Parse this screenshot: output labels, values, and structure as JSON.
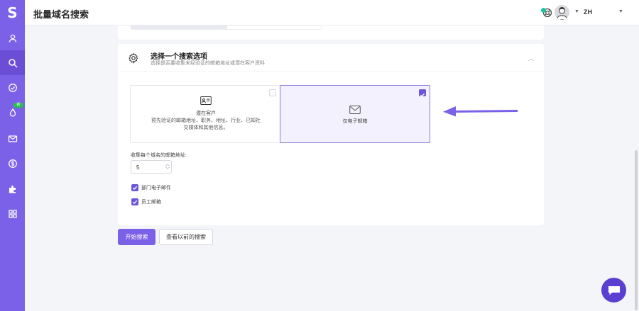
{
  "app": {
    "logo_letter": "S",
    "page_title": "批量域名搜索",
    "lang": "ZH",
    "new_badge": "新"
  },
  "sidebar": {
    "items": [
      {
        "icon": "user-icon"
      },
      {
        "icon": "search-icon",
        "active": true
      },
      {
        "icon": "check-circle-icon"
      },
      {
        "icon": "fire-icon"
      },
      {
        "icon": "mail-icon"
      },
      {
        "icon": "dollar-icon"
      },
      {
        "icon": "puzzle-icon"
      },
      {
        "icon": "grid-icon"
      }
    ]
  },
  "card": {
    "title": "选择一个搜索选项",
    "subtitle": "选择是否要收集未经验证的邮箱地址或潜在客户资料"
  },
  "options": {
    "left": {
      "label": "潜在客户",
      "desc_line1": "预先验证的邮箱地址、职务、地址、行业、已知社",
      "desc_line2": "交媒体和其他信息。",
      "selected": false
    },
    "right": {
      "label": "仅电子邮箱",
      "selected": true
    }
  },
  "form": {
    "per_domain_label": "收集每个域名的邮箱地址:",
    "per_domain_value": "5",
    "checkboxes": [
      {
        "label": "部门电子邮件",
        "checked": true
      },
      {
        "label": "员工邮箱",
        "checked": true
      }
    ]
  },
  "buttons": {
    "start": "开始搜索",
    "history": "查看以前的搜索"
  },
  "colors": {
    "brand": "#7b61e8",
    "accent": "#6b55d9",
    "online": "#1bc5a4"
  }
}
